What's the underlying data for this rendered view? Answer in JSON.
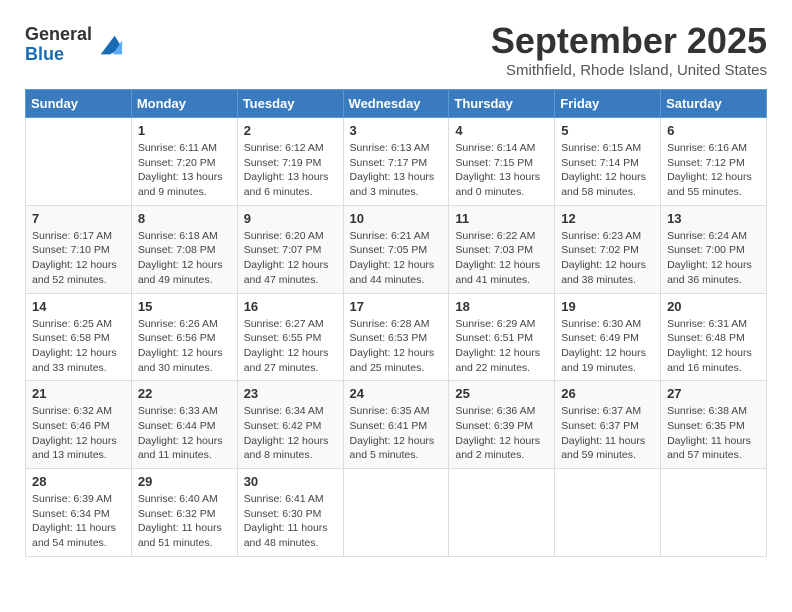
{
  "header": {
    "logo_general": "General",
    "logo_blue": "Blue",
    "month_title": "September 2025",
    "location": "Smithfield, Rhode Island, United States"
  },
  "weekdays": [
    "Sunday",
    "Monday",
    "Tuesday",
    "Wednesday",
    "Thursday",
    "Friday",
    "Saturday"
  ],
  "weeks": [
    [
      {
        "day": "",
        "info": ""
      },
      {
        "day": "1",
        "info": "Sunrise: 6:11 AM\nSunset: 7:20 PM\nDaylight: 13 hours\nand 9 minutes."
      },
      {
        "day": "2",
        "info": "Sunrise: 6:12 AM\nSunset: 7:19 PM\nDaylight: 13 hours\nand 6 minutes."
      },
      {
        "day": "3",
        "info": "Sunrise: 6:13 AM\nSunset: 7:17 PM\nDaylight: 13 hours\nand 3 minutes."
      },
      {
        "day": "4",
        "info": "Sunrise: 6:14 AM\nSunset: 7:15 PM\nDaylight: 13 hours\nand 0 minutes."
      },
      {
        "day": "5",
        "info": "Sunrise: 6:15 AM\nSunset: 7:14 PM\nDaylight: 12 hours\nand 58 minutes."
      },
      {
        "day": "6",
        "info": "Sunrise: 6:16 AM\nSunset: 7:12 PM\nDaylight: 12 hours\nand 55 minutes."
      }
    ],
    [
      {
        "day": "7",
        "info": "Sunrise: 6:17 AM\nSunset: 7:10 PM\nDaylight: 12 hours\nand 52 minutes."
      },
      {
        "day": "8",
        "info": "Sunrise: 6:18 AM\nSunset: 7:08 PM\nDaylight: 12 hours\nand 49 minutes."
      },
      {
        "day": "9",
        "info": "Sunrise: 6:20 AM\nSunset: 7:07 PM\nDaylight: 12 hours\nand 47 minutes."
      },
      {
        "day": "10",
        "info": "Sunrise: 6:21 AM\nSunset: 7:05 PM\nDaylight: 12 hours\nand 44 minutes."
      },
      {
        "day": "11",
        "info": "Sunrise: 6:22 AM\nSunset: 7:03 PM\nDaylight: 12 hours\nand 41 minutes."
      },
      {
        "day": "12",
        "info": "Sunrise: 6:23 AM\nSunset: 7:02 PM\nDaylight: 12 hours\nand 38 minutes."
      },
      {
        "day": "13",
        "info": "Sunrise: 6:24 AM\nSunset: 7:00 PM\nDaylight: 12 hours\nand 36 minutes."
      }
    ],
    [
      {
        "day": "14",
        "info": "Sunrise: 6:25 AM\nSunset: 6:58 PM\nDaylight: 12 hours\nand 33 minutes."
      },
      {
        "day": "15",
        "info": "Sunrise: 6:26 AM\nSunset: 6:56 PM\nDaylight: 12 hours\nand 30 minutes."
      },
      {
        "day": "16",
        "info": "Sunrise: 6:27 AM\nSunset: 6:55 PM\nDaylight: 12 hours\nand 27 minutes."
      },
      {
        "day": "17",
        "info": "Sunrise: 6:28 AM\nSunset: 6:53 PM\nDaylight: 12 hours\nand 25 minutes."
      },
      {
        "day": "18",
        "info": "Sunrise: 6:29 AM\nSunset: 6:51 PM\nDaylight: 12 hours\nand 22 minutes."
      },
      {
        "day": "19",
        "info": "Sunrise: 6:30 AM\nSunset: 6:49 PM\nDaylight: 12 hours\nand 19 minutes."
      },
      {
        "day": "20",
        "info": "Sunrise: 6:31 AM\nSunset: 6:48 PM\nDaylight: 12 hours\nand 16 minutes."
      }
    ],
    [
      {
        "day": "21",
        "info": "Sunrise: 6:32 AM\nSunset: 6:46 PM\nDaylight: 12 hours\nand 13 minutes."
      },
      {
        "day": "22",
        "info": "Sunrise: 6:33 AM\nSunset: 6:44 PM\nDaylight: 12 hours\nand 11 minutes."
      },
      {
        "day": "23",
        "info": "Sunrise: 6:34 AM\nSunset: 6:42 PM\nDaylight: 12 hours\nand 8 minutes."
      },
      {
        "day": "24",
        "info": "Sunrise: 6:35 AM\nSunset: 6:41 PM\nDaylight: 12 hours\nand 5 minutes."
      },
      {
        "day": "25",
        "info": "Sunrise: 6:36 AM\nSunset: 6:39 PM\nDaylight: 12 hours\nand 2 minutes."
      },
      {
        "day": "26",
        "info": "Sunrise: 6:37 AM\nSunset: 6:37 PM\nDaylight: 11 hours\nand 59 minutes."
      },
      {
        "day": "27",
        "info": "Sunrise: 6:38 AM\nSunset: 6:35 PM\nDaylight: 11 hours\nand 57 minutes."
      }
    ],
    [
      {
        "day": "28",
        "info": "Sunrise: 6:39 AM\nSunset: 6:34 PM\nDaylight: 11 hours\nand 54 minutes."
      },
      {
        "day": "29",
        "info": "Sunrise: 6:40 AM\nSunset: 6:32 PM\nDaylight: 11 hours\nand 51 minutes."
      },
      {
        "day": "30",
        "info": "Sunrise: 6:41 AM\nSunset: 6:30 PM\nDaylight: 11 hours\nand 48 minutes."
      },
      {
        "day": "",
        "info": ""
      },
      {
        "day": "",
        "info": ""
      },
      {
        "day": "",
        "info": ""
      },
      {
        "day": "",
        "info": ""
      }
    ]
  ]
}
